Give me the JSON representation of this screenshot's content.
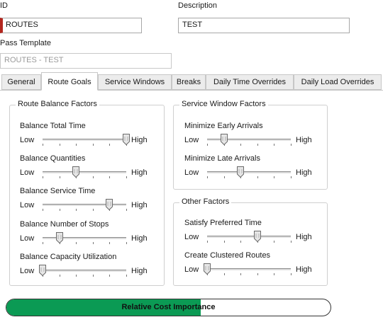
{
  "form": {
    "id_label": "ID",
    "id_value": "ROUTES",
    "description_label": "Description",
    "description_value": "TEST",
    "pass_template_label": "Pass Template",
    "pass_template_value": "ROUTES - TEST"
  },
  "tabs": [
    {
      "label": "General"
    },
    {
      "label": "Route Goals",
      "selected": true
    },
    {
      "label": "Service Windows"
    },
    {
      "label": "Breaks"
    },
    {
      "label": "Daily Time Overrides"
    },
    {
      "label": "Daily Load Overrides"
    }
  ],
  "route_balance": {
    "title": "Route Balance Factors",
    "sliders": [
      {
        "label": "Balance Total Time",
        "low": "Low",
        "high": "High",
        "value": 1.0
      },
      {
        "label": "Balance Quantities",
        "low": "Low",
        "high": "High",
        "value": 0.4
      },
      {
        "label": "Balance Service Time",
        "low": "Low",
        "high": "High",
        "value": 0.8
      },
      {
        "label": "Balance Number of Stops",
        "low": "Low",
        "high": "High",
        "value": 0.2
      },
      {
        "label": "Balance Capacity Utilization",
        "low": "Low",
        "high": "High",
        "value": 0.0
      }
    ]
  },
  "service_window": {
    "title": "Service Window Factors",
    "sliders": [
      {
        "label": "Minimize Early Arrivals",
        "low": "Low",
        "high": "High",
        "value": 0.2
      },
      {
        "label": "Minimize Late Arrivals",
        "low": "Low",
        "high": "High",
        "value": 0.4
      }
    ]
  },
  "other": {
    "title": "Other Factors",
    "sliders": [
      {
        "label": "Satisfy Preferred Time",
        "low": "Low",
        "high": "High",
        "value": 0.6
      },
      {
        "label": "Create Clustered Routes",
        "low": "Low",
        "high": "High",
        "value": 0.0
      }
    ]
  },
  "relative_cost": {
    "label": "Relative Cost Importance",
    "value": 0.6,
    "fill_color": "#0b9a54"
  },
  "colors": {
    "required_marker": "#b3261e",
    "tab_inactive": "#ececec"
  }
}
